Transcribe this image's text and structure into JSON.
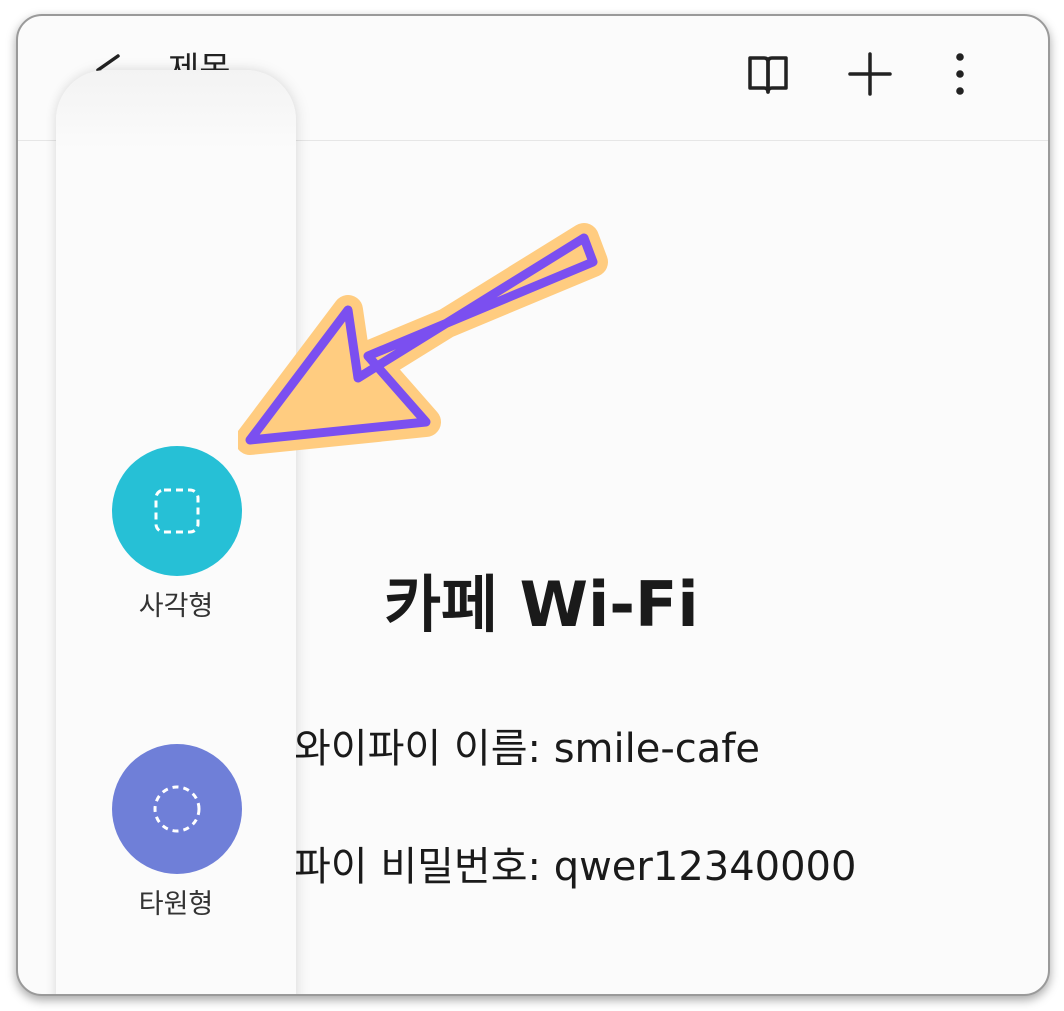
{
  "header": {
    "title": "제목",
    "icons": [
      "back-icon",
      "reading-mode-icon",
      "add-icon",
      "more-icon"
    ]
  },
  "note": {
    "title": "카페 Wi-Fi",
    "line1": "와이파이 이름: smile-cafe",
    "line2": "파이 비밀번호: qwer12340000"
  },
  "shape_panel": {
    "items": [
      {
        "label": "사각형",
        "icon": "dashed-square-icon",
        "color": "#26c0d6"
      },
      {
        "label": "타원형",
        "icon": "dashed-circle-icon",
        "color": "#6f7fd8"
      }
    ]
  },
  "annotation": {
    "arrow_fill": "#ffcc80",
    "arrow_stroke": "#7b4ff0"
  }
}
